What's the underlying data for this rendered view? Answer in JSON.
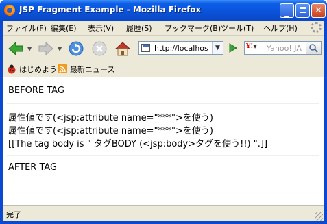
{
  "window": {
    "title": "JSP Fragment Example - Mozilla Firefox"
  },
  "menu": {
    "items": [
      "ファイル(F)",
      "編集(E)",
      "表示(V)",
      "履歴(S)",
      "ブックマーク(B)",
      "ツール(T)",
      "ヘルプ(H)"
    ]
  },
  "toolbar": {
    "address_value": "http://localhos",
    "search_engine_label": "Y!",
    "search_placeholder": "Yahoo! JA"
  },
  "bookmarks": {
    "items": [
      "はじめよう",
      "最新ニュース"
    ]
  },
  "page": {
    "before_tag": "BEFORE TAG",
    "attribute_line_1": "属性値です(<jsp:attribute name=\"***\">を使う)",
    "attribute_line_2": "属性値です(<jsp:attribute name=\"***\">を使う)",
    "body_line": "[[The tag body is \" タグBODY (<jsp:body>タグを使う!!) \".]]",
    "after_tag": "AFTER TAG"
  },
  "status": {
    "text": "完了"
  },
  "colors": {
    "titlebar_blue": "#0a52d8",
    "chrome_beige": "#ece9d8",
    "close_red": "#c9401c",
    "nav_green": "#3aa534"
  },
  "icons": [
    "firefox-icon",
    "back-arrow-icon",
    "forward-arrow-icon",
    "reload-icon",
    "stop-icon",
    "home-icon",
    "go-icon",
    "search-icon",
    "ladybug-icon",
    "rss-feed-icon"
  ]
}
